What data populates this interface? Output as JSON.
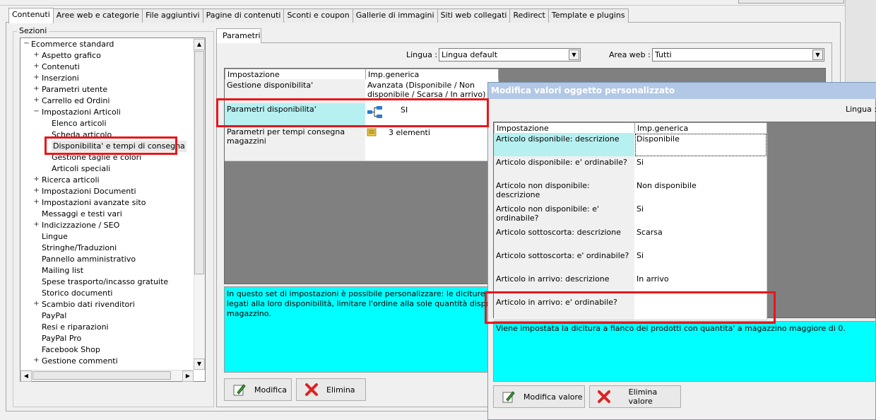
{
  "tabs": [
    "Contenuti",
    "Aree web e categorie",
    "File aggiuntivi",
    "Pagine di contenuti",
    "Sconti e coupon",
    "Gallerie di immagini",
    "Siti web collegati",
    "Redirect",
    "Template e plugins"
  ],
  "sections": {
    "label": "Sezioni",
    "tree": [
      {
        "label": "Ecommerce standard",
        "level": 0,
        "exp": "−"
      },
      {
        "label": "Aspetto grafico",
        "level": 1,
        "exp": "+"
      },
      {
        "label": "Contenuti",
        "level": 1,
        "exp": "+"
      },
      {
        "label": "Inserzioni",
        "level": 1,
        "exp": "+"
      },
      {
        "label": "Parametri utente",
        "level": 1,
        "exp": "+"
      },
      {
        "label": "Carrello ed Ordini",
        "level": 1,
        "exp": "+"
      },
      {
        "label": "Impostazioni Articoli",
        "level": 1,
        "exp": "−"
      },
      {
        "label": "Elenco articoli",
        "level": 2,
        "exp": ""
      },
      {
        "label": "Scheda articolo",
        "level": 2,
        "exp": ""
      },
      {
        "label": "Disponibilita' e tempi di consegna",
        "level": 2,
        "exp": "",
        "selected": true
      },
      {
        "label": "Gestione taglie e colori",
        "level": 2,
        "exp": ""
      },
      {
        "label": "Articoli speciali",
        "level": 2,
        "exp": ""
      },
      {
        "label": "Ricerca articoli",
        "level": 1,
        "exp": "+"
      },
      {
        "label": "Impostazioni Documenti",
        "level": 1,
        "exp": "+"
      },
      {
        "label": "Impostazioni avanzate sito",
        "level": 1,
        "exp": "+"
      },
      {
        "label": "Messaggi e testi vari",
        "level": 1,
        "exp": ""
      },
      {
        "label": "Indicizzazione / SEO",
        "level": 1,
        "exp": "+"
      },
      {
        "label": "Lingue",
        "level": 1,
        "exp": ""
      },
      {
        "label": "Stringhe/Traduzioni",
        "level": 1,
        "exp": ""
      },
      {
        "label": "Pannello amministrativo",
        "level": 1,
        "exp": ""
      },
      {
        "label": "Mailing list",
        "level": 1,
        "exp": ""
      },
      {
        "label": "Spese trasporto/incasso gratuite",
        "level": 1,
        "exp": ""
      },
      {
        "label": "Storico documenti",
        "level": 1,
        "exp": ""
      },
      {
        "label": "Scambio dati rivenditori",
        "level": 1,
        "exp": "+"
      },
      {
        "label": "PayPal",
        "level": 1,
        "exp": ""
      },
      {
        "label": "Resi e riparazioni",
        "level": 1,
        "exp": ""
      },
      {
        "label": "PayPal Pro",
        "level": 1,
        "exp": ""
      },
      {
        "label": "Facebook Shop",
        "level": 1,
        "exp": ""
      },
      {
        "label": "Gestione commenti",
        "level": 1,
        "exp": "+"
      }
    ]
  },
  "params": {
    "tab": "Parametri",
    "lingua_label": "Lingua :",
    "lingua_value": "Lingua default",
    "area_label": "Area web :",
    "area_value": "Tutti",
    "columns": [
      "Impostazione",
      "Imp.generica"
    ],
    "rows": [
      {
        "setting": "Gestione disponibilita'",
        "value": "Avanzata (Disponibile / Non disponibile / Scarsa / In arrivo)"
      },
      {
        "setting": "Parametri disponibilita'",
        "value": "SI",
        "icon": "tree-structure-icon"
      },
      {
        "setting": "Parametri per tempi consegna magazzini",
        "value": "3 elementi",
        "icon": "folder-list-icon"
      }
    ],
    "description": "In questo set di impostazioni è possibile personalizzare: le diciture per i vari stati legati alla loro disponibilità, limitare l'ordine alla sole quantità disponibili a magazzino.",
    "btn_edit": "Modifica",
    "btn_delete": "Elimina"
  },
  "dialog": {
    "title": "Modifica valori oggetto personalizzato",
    "lingua_label": "Lingua :",
    "columns": [
      "Impostazione",
      "Imp.generica"
    ],
    "rows": [
      {
        "setting": "Articolo disponibile: descrizione",
        "value": "Disponibile"
      },
      {
        "setting": "Articolo disponibile: e' ordinabile?",
        "value": "Si"
      },
      {
        "setting": "Articolo non disponibile: descrizione",
        "value": "Non disponibile"
      },
      {
        "setting": "Articolo non disponibile: e' ordinabile?",
        "value": "Si"
      },
      {
        "setting": "Articolo sottoscorta: descrizione",
        "value": "Scarsa"
      },
      {
        "setting": "Articolo sottoscorta: e' ordinabile?",
        "value": "Si"
      },
      {
        "setting": "Articolo in arrivo: descrizione",
        "value": "In arrivo"
      },
      {
        "setting": "Articolo in arrivo: e' ordinabile?",
        "value": ""
      }
    ],
    "description": "Viene impostata la dicitura a fianco dei prodotti con quantita' a magazzino maggiore di 0.",
    "btn_edit": "Modifica valore",
    "btn_delete": "Elimina valore"
  },
  "colors": {
    "accent_cyan": "#00ffff",
    "highlight": "#e8161c",
    "title_bar": "#b3c8e6"
  }
}
